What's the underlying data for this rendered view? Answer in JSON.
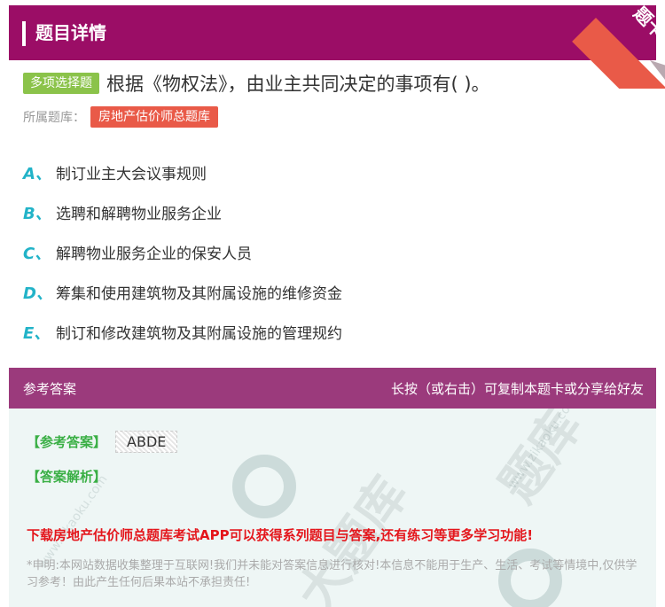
{
  "header": {
    "title": "题目详情"
  },
  "ribbon": {
    "label": "题卡"
  },
  "question": {
    "type_tag": "多项选择题",
    "text": "根据《物权法》，由业主共同决定的事项有( )。"
  },
  "bank": {
    "label": "所属题库：",
    "name": "房地产估价师总题库"
  },
  "options": [
    {
      "letter": "A、",
      "text": "制订业主大会议事规则"
    },
    {
      "letter": "B、",
      "text": "选聘和解聘物业服务企业"
    },
    {
      "letter": "C、",
      "text": "解聘物业服务企业的保安人员"
    },
    {
      "letter": "D、",
      "text": "筹集和使用建筑物及其附属设施的维修资金"
    },
    {
      "letter": "E、",
      "text": "制订和修改建筑物及其附属设施的管理规约"
    }
  ],
  "answer_section": {
    "title": "参考答案",
    "copy_hint": "长按（或右击）可复制本题卡或分享给好友",
    "answer_label": "【参考答案】",
    "answer_value": "ABDE",
    "analysis_label": "【答案解析】",
    "promo": "下载房地产估价师总题库考试APP可以获得系列题目与答案,还有练习等更多学习功能!",
    "disclaimer": "*申明:本网站数据收集整理于互联网!我们并未能对答案信息进行核对!本信息不能用于生产、生活、考试等情境中,仅供学习参考！由此产生任何后果本站不承担责任!"
  },
  "colors": {
    "header_bg": "#9b0d66",
    "answer_header_bg": "#9b3a7c",
    "type_tag": "#8bc34a",
    "bank_tag": "#e95a48",
    "option_letter": "#22b3c8",
    "answer_label": "#3aaf45",
    "promo": "#e4161c"
  }
}
